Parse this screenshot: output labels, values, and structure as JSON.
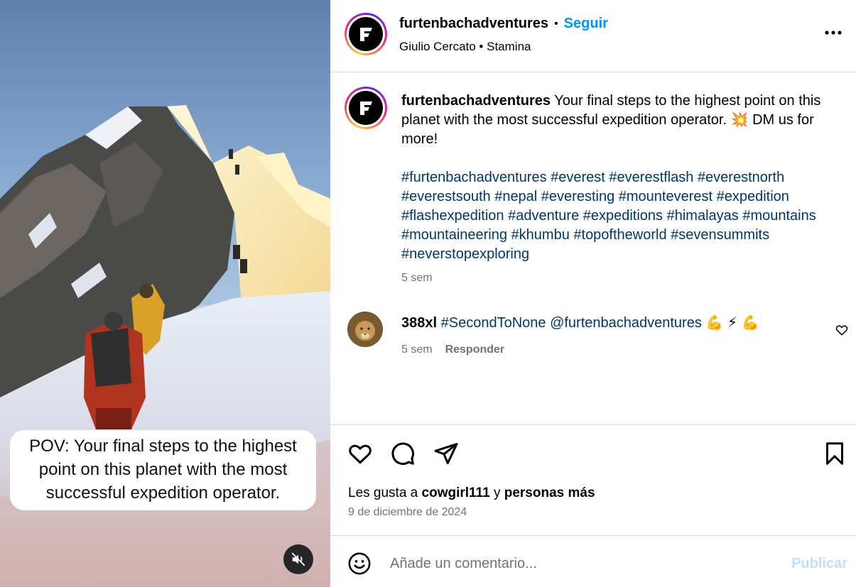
{
  "media": {
    "overlay_caption": [
      "POV: Your final steps to the highest",
      "point on this planet with the most",
      "successful expedition operator."
    ],
    "mute_icon": "volume-muted-icon"
  },
  "header": {
    "username": "furtenbachadventures",
    "separator": "•",
    "follow_label": "Seguir",
    "audio_line": "Giulio Cercato • Stamina",
    "more_icon": "more-options-icon"
  },
  "caption": {
    "username": "furtenbachadventures",
    "text": "Your final steps to the highest point on this planet with the most successful expedition operator.",
    "emoji": "💥",
    "text_after": "DM us for more!",
    "hashtags": "#furtenbachadventures #everest #everestflash #everestnorth #everestsouth #nepal #everesting #mounteverest #expedition #flashexpedition #adventure #expeditions #himalayas #mountains #mountaineering #khumbu #topoftheworld #sevensummits #neverstopexploring",
    "time": "5 sem"
  },
  "comments": [
    {
      "username": "388xl",
      "text": "#SecondToNone @furtenbachadventures",
      "emojis": "💪 ⚡ 💪",
      "time": "5 sem",
      "reply_label": "Responder"
    }
  ],
  "actions": {
    "likes_prefix": "Les gusta a",
    "likes_user": "cowgirl111",
    "likes_joiner": "y",
    "likes_suffix": "personas más",
    "date": "9 de diciembre de 2024"
  },
  "comment_box": {
    "placeholder": "Añade un comentario...",
    "publish_label": "Publicar"
  },
  "colors": {
    "link_blue": "#0095f6",
    "hashtag": "#00376b",
    "muted_text": "#737373",
    "publish_disabled": "#c0dffd",
    "divider": "#dbdbdb"
  }
}
